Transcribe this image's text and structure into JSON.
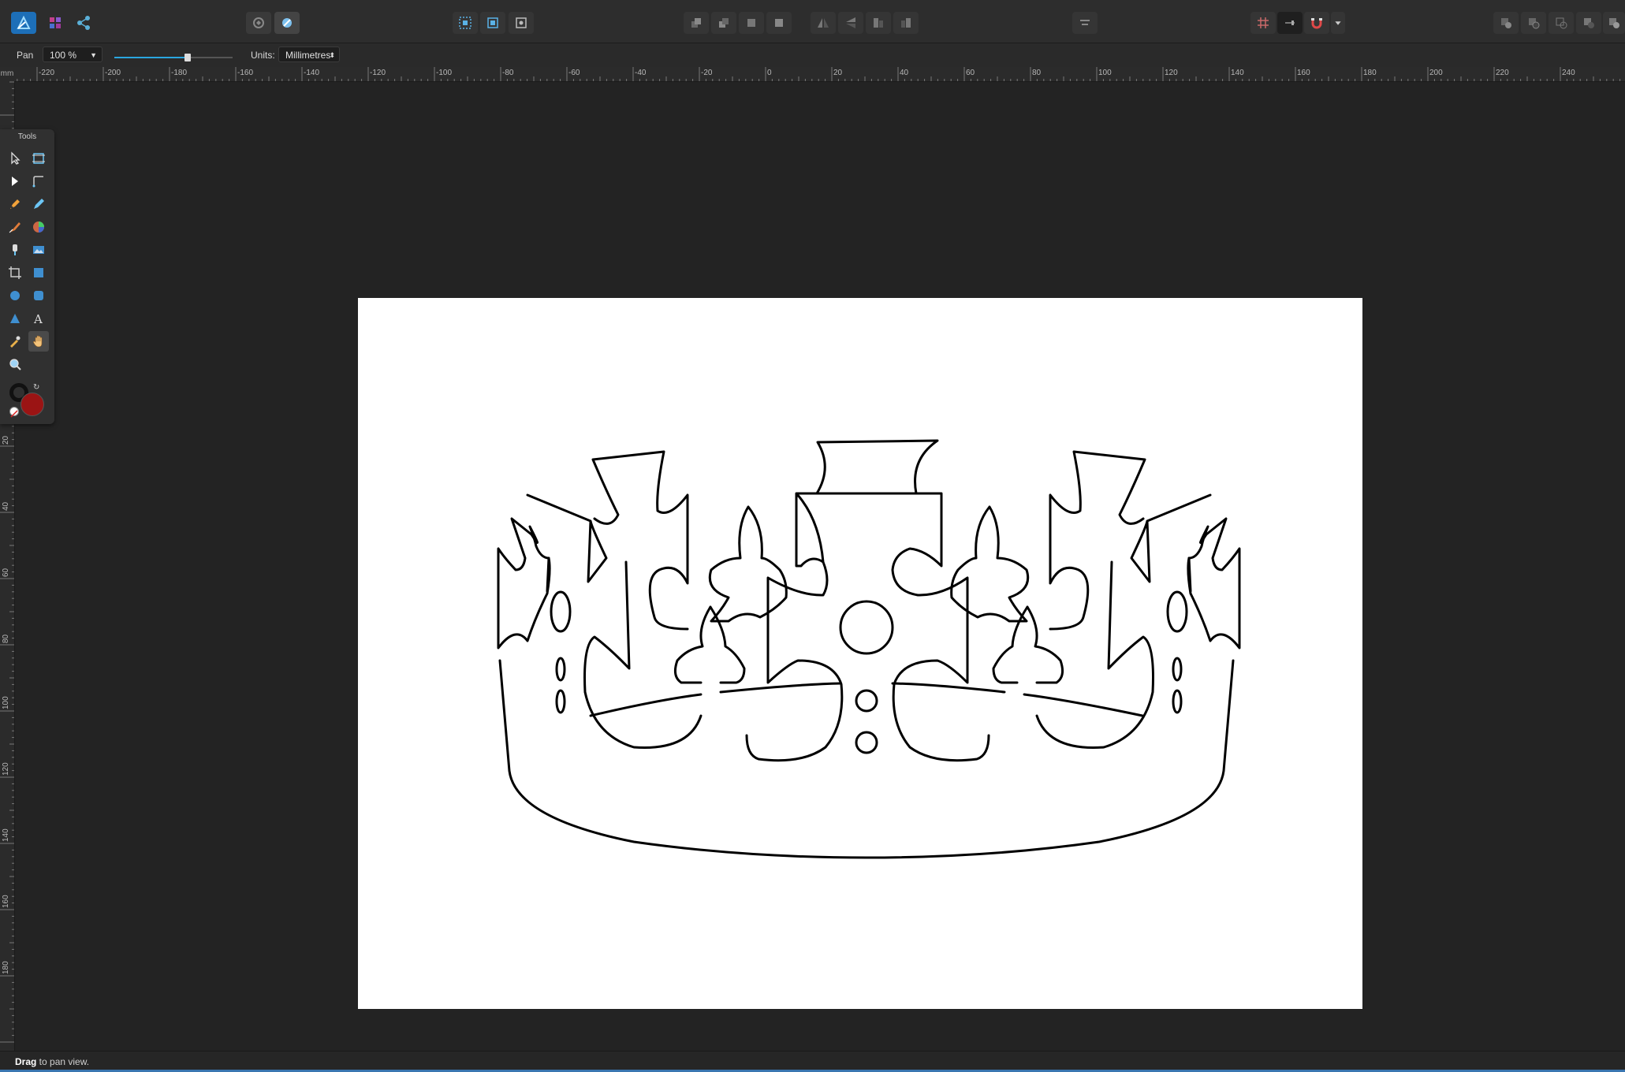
{
  "toolbar": {
    "personas": [
      "designer-persona-icon",
      "pixel-persona-icon",
      "export-persona-icon"
    ]
  },
  "context": {
    "tool_label": "Pan",
    "zoom_value": "100 %",
    "zoom_slider_fraction": 0.62,
    "units_label": "Units:",
    "units_value": "Millimetres"
  },
  "ruler": {
    "unit": "mm",
    "h_labels": [
      "-220",
      "-200",
      "-180",
      "-160",
      "-140",
      "-120",
      "-100",
      "-80",
      "-60",
      "-40",
      "-20",
      "0",
      "20",
      "40",
      "60",
      "80",
      "100",
      "120",
      "140",
      "160",
      "180",
      "200",
      "220",
      "240"
    ],
    "v_labels": [
      "20",
      "40",
      "60",
      "80",
      "100",
      "120",
      "140",
      "160",
      "180"
    ]
  },
  "tools_panel": {
    "title": "Tools",
    "active_tool": "view-hand-tool",
    "fill_color": "#9b1414",
    "stroke_color": "#111111"
  },
  "status": {
    "bold": "Drag",
    "rest": " to pan view."
  },
  "colors": {
    "accent": "#2aa6e0",
    "app_bg": "#232323",
    "panel_bg": "#303030"
  }
}
